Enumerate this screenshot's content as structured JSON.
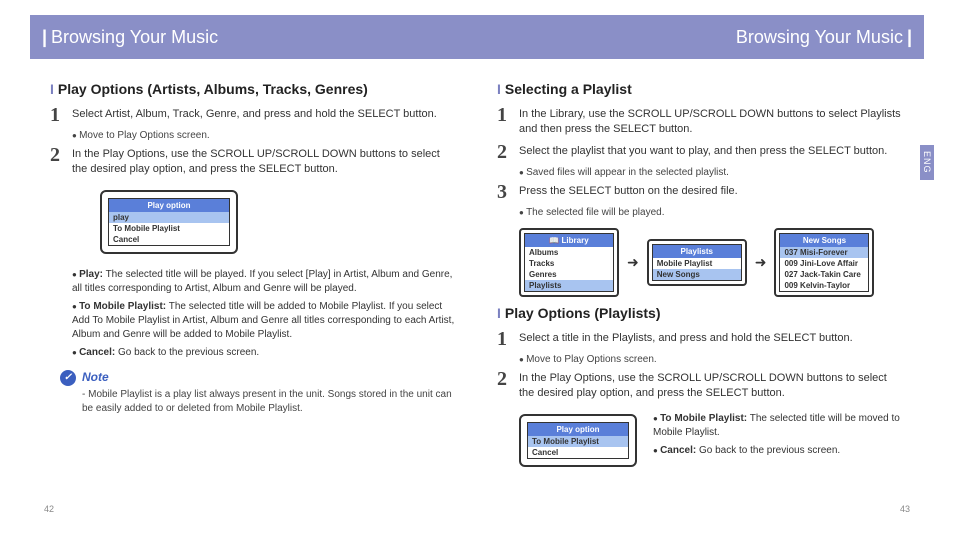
{
  "header": {
    "title_left": "Browsing Your Music",
    "title_right": "Browsing Your Music"
  },
  "lang_tab": "ENG",
  "pages": {
    "left": "42",
    "right": "43"
  },
  "left": {
    "section1": {
      "title": "Play Options (Artists, Albums, Tracks, Genres)",
      "step1": "Select Artist, Album, Track, Genre, and press and hold the SELECT button.",
      "step1_sub": "Move to Play Options screen.",
      "step2": "In the Play Options, use the SCROLL UP/SCROLL DOWN buttons to select the desired play option, and press the SELECT button.",
      "screen": {
        "title": "Play option",
        "rows": [
          "play",
          "To Mobile Playlist",
          "Cancel"
        ],
        "selected": 0
      },
      "bullets": [
        {
          "label": "Play:",
          "text": "The selected title will be played. If you select [Play] in Artist, Album and Genre, all titles corresponding to Artist, Album and Genre will be played."
        },
        {
          "label": "To Mobile Playlist:",
          "text": "The selected title will be added to Mobile Playlist. If you select Add To Mobile Playlist in Artist, Album and Genre all titles corresponding to each Artist, Album and Genre will be added to Mobile Playlist."
        },
        {
          "label": "Cancel:",
          "text": "Go back to the previous screen."
        }
      ],
      "note_label": "Note",
      "note_text": "- Mobile Playlist is a play list always present in the unit. Songs stored in the unit can be easily added to or deleted from Mobile Playlist."
    }
  },
  "right": {
    "section1": {
      "title": "Selecting a Playlist",
      "step1": "In the Library, use the SCROLL UP/SCROLL DOWN buttons to select Playlists and then press the SELECT button.",
      "step2": "Select the playlist that you want to play, and then press the SELECT button.",
      "step2_sub": "Saved files will appear in the selected playlist.",
      "step3": "Press the SELECT button on the desired file.",
      "step3_sub": "The selected file will be played.",
      "screens": {
        "s1": {
          "title": "Library",
          "rows": [
            "Albums",
            "Tracks",
            "Genres",
            "Playlists"
          ],
          "selected": 3,
          "icon": "library"
        },
        "s2": {
          "title": "Playlists",
          "rows": [
            "Mobile Playlist",
            "New Songs"
          ],
          "selected": 1
        },
        "s3": {
          "title": "New Songs",
          "rows": [
            "037 Misi-Forever",
            "009 Jini-Love Affair",
            "027 Jack-Takin Care",
            "009 Kelvin-Taylor"
          ],
          "selected": 0
        }
      }
    },
    "section2": {
      "title": "Play Options (Playlists)",
      "step1": "Select a title in the Playlists, and press and hold the SELECT button.",
      "step1_sub": "Move to Play Options screen.",
      "step2": "In the Play Options, use the SCROLL UP/SCROLL DOWN buttons to select the desired play option, and press the SELECT button.",
      "screen": {
        "title": "Play option",
        "rows": [
          "To Mobile Playlist",
          "Cancel"
        ],
        "selected": 0
      },
      "bullets": [
        {
          "label": "To Mobile Playlist:",
          "text": "The selected title will be moved to Mobile Playlist."
        },
        {
          "label": "Cancel:",
          "text": "Go back to the previous screen."
        }
      ]
    }
  }
}
